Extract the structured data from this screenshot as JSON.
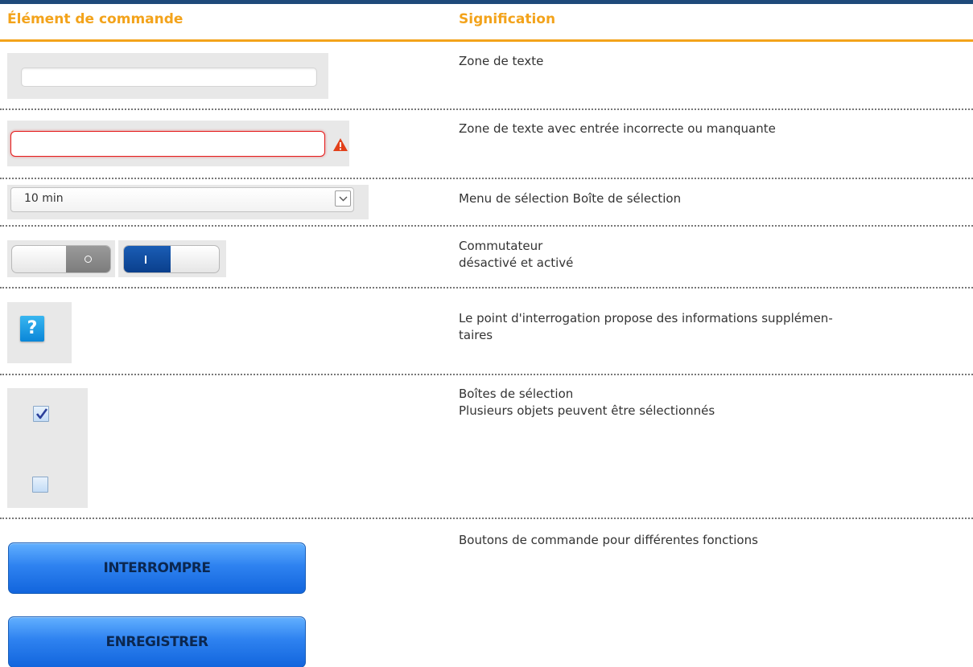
{
  "headers": {
    "element": "Élément de commande",
    "meaning": "Signification"
  },
  "colors": {
    "accent": "#f3a31b",
    "topbar": "#1f4a7a",
    "error": "#e51b1b",
    "toggle_on": "#0a3f8c",
    "button": "#2e82f0"
  },
  "rows": [
    {
      "meaning": [
        "Zone de texte"
      ]
    },
    {
      "meaning": [
        "Zone de texte avec entrée incorrecte ou manquante"
      ],
      "icon": "warning-icon"
    },
    {
      "meaning": [
        "Menu de sélection Boîte de sélection"
      ],
      "select_value": "10 min",
      "icon": "chevron-down-icon"
    },
    {
      "meaning": [
        "Commutateur",
        "désactivé et activé"
      ],
      "toggle_off_glyph": "O",
      "toggle_on_glyph": "I"
    },
    {
      "meaning": [
        "Le point d'interrogation propose des informations supplémen-",
        "taires"
      ],
      "help_glyph": "?"
    },
    {
      "meaning": [
        "Boîtes de sélection",
        "Plusieurs objets peuvent être sélectionnés"
      ],
      "checked": [
        true,
        false
      ]
    },
    {
      "meaning": [
        "Boutons de commande pour différentes fonctions"
      ],
      "buttons": [
        "INTERROMPRE",
        "ENREGISTRER"
      ]
    }
  ]
}
